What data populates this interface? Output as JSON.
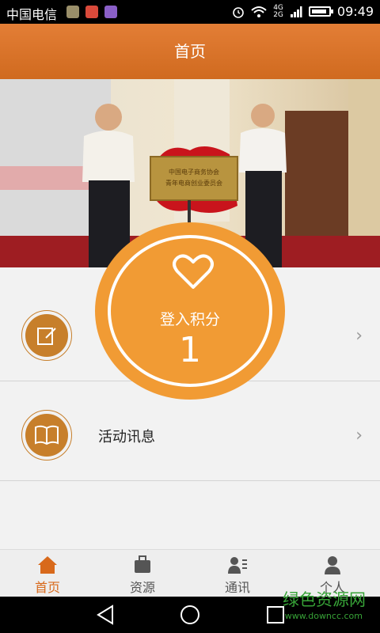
{
  "status_bar": {
    "carrier": "中国电信",
    "network_top": "4G",
    "network_bottom": "2G",
    "time": "09:49"
  },
  "header": {
    "title": "首页"
  },
  "banner": {
    "plaque_line1": "中国电子商务协会",
    "plaque_line2": "青年电商创业委员会"
  },
  "points_badge": {
    "label": "登入积分",
    "value": "1",
    "icon": "heart-icon"
  },
  "list": {
    "items": [
      {
        "label": "",
        "icon": "edit-icon"
      },
      {
        "label": "活动讯息",
        "icon": "book-icon"
      }
    ]
  },
  "tabs": [
    {
      "label": "首页",
      "icon": "home-icon",
      "active": true
    },
    {
      "label": "资源",
      "icon": "briefcase-icon",
      "active": false
    },
    {
      "label": "通讯",
      "icon": "contacts-icon",
      "active": false
    },
    {
      "label": "个人",
      "icon": "person-icon",
      "active": false
    }
  ],
  "watermark": {
    "text": "绿色资源网",
    "url": "www.downcc.com"
  },
  "colors": {
    "header": "#d8722a",
    "accent": "#f19b34",
    "icon_brown": "#c77f2b",
    "active_tab": "#d8691b"
  }
}
